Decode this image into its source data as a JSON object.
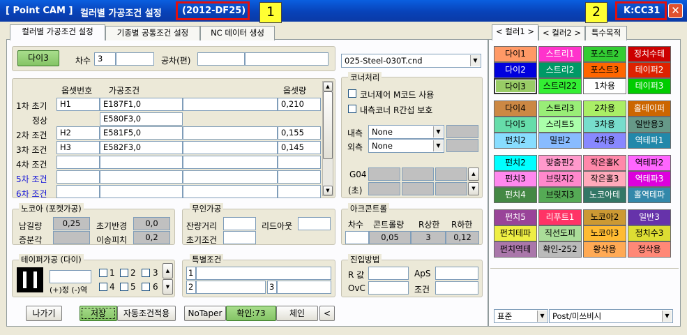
{
  "title": {
    "app": "[ Point CAM ]",
    "screen": "컬러별 가공조건 설정",
    "code": "(2012-DF25)",
    "marker1": "1",
    "marker2": "2",
    "machine": "K:CC31",
    "close": "✕"
  },
  "tabs": [
    "컬러별 가공조건 설정",
    "기종별 공통조건 설정",
    "NC 데이터 생성"
  ],
  "color_tabs": [
    "< 컬러1 >",
    "< 컬러2 >",
    "특수목적"
  ],
  "top": {
    "dia_btn": "다이3",
    "cha_label": "차수",
    "cha_value": "3",
    "gongcha_label": "공차(편)",
    "file": "025-Steel-030T.cnd"
  },
  "offset": {
    "col_offset_no": "옵셋번호",
    "col_cond": "가공조건",
    "col_amount": "옵셋량",
    "rows": [
      {
        "label": "1차 초기",
        "no": "H1",
        "cond": "E187F1,0",
        "amount": "0,210"
      },
      {
        "label": "정상",
        "no": "",
        "cond": "E580F3,0",
        "amount": ""
      },
      {
        "label": "2차 조건",
        "no": "H2",
        "cond": "E581F5,0",
        "amount": "0,155"
      },
      {
        "label": "3차 조건",
        "no": "H3",
        "cond": "E582F3,0",
        "amount": "0,145"
      },
      {
        "label": "4차 조건",
        "no": "",
        "cond": "",
        "amount": ""
      },
      {
        "label": "5차 조건",
        "no": "",
        "cond": "",
        "amount": ""
      },
      {
        "label": "6차 조건",
        "no": "",
        "cond": "",
        "amount": ""
      }
    ]
  },
  "corner": {
    "title": "코너처리",
    "opt1": "코너제어 M코드 사용",
    "opt2": "내측코너 R간섭 보호",
    "inner_label": "내측",
    "inner_val": "None",
    "outer_label": "외측",
    "outer_val": "None",
    "g04": "G04",
    "sec": "(초)"
  },
  "noaoa": {
    "title": "노코아 (포켓가공)",
    "rem_label": "남길량",
    "rem_val": "0,25",
    "r_label": "초기반경",
    "r_val": "0,0",
    "inc_label": "증분각",
    "pitch_label": "이송피치",
    "pitch_val": "0,2"
  },
  "unmanned": {
    "title": "무인가공",
    "dist_label": "잔량거리",
    "leadout_label": "리드아웃",
    "init_label": "초기조건"
  },
  "arc": {
    "title": "아크콘트롤",
    "h1": "차수",
    "h2": "콘트롤량",
    "h3": "R상한",
    "h4": "R하한",
    "v2": "0,05",
    "v3": "3",
    "v4": "0,12"
  },
  "taper": {
    "title": "테이퍼가공 (다이)",
    "sign": "(+)정 (-)역",
    "c1": "1",
    "c2": "2",
    "c3": "3",
    "c4": "4",
    "c5": "5",
    "c6": "6"
  },
  "special": {
    "title": "특별조건",
    "n1": "1",
    "n2": "2",
    "n3": "3"
  },
  "approach": {
    "title": "진입방법",
    "r_label": "R 값",
    "aps_label": "ApS",
    "ovc_label": "OvC",
    "cond_label": "조건"
  },
  "bottom": {
    "exit": "나가기",
    "save": "저장",
    "auto": "자동조건적용",
    "notaper": "NoTaper",
    "confirm": "확인:73",
    "chain": "체인",
    "back": "<"
  },
  "palette": [
    [
      {
        "t": "다이1",
        "bg": "#ff9966"
      },
      {
        "t": "스트리1",
        "bg": "#ff33cc"
      },
      {
        "t": "포스트2",
        "bg": "#33cc33"
      },
      {
        "t": "정치수테",
        "bg": "#cc0000"
      }
    ],
    [
      {
        "t": "다이2",
        "bg": "#0000dd"
      },
      {
        "t": "스트리2",
        "bg": "#009966"
      },
      {
        "t": "포스트3",
        "bg": "#ff6600"
      },
      {
        "t": "테이퍼2",
        "bg": "#dd2200"
      }
    ],
    [
      {
        "t": "다이3",
        "bg": "#99cc66"
      },
      {
        "t": "스트리22",
        "bg": "#33ee33"
      },
      {
        "t": "1차용",
        "bg": "#ffffff"
      },
      {
        "t": "테이퍼3",
        "bg": "#00cc00"
      }
    ],
    [
      {
        "t": "다이4",
        "bg": "#cc8844"
      },
      {
        "t": "스트리3",
        "bg": "#99ee77"
      },
      {
        "t": "2차용",
        "bg": "#aaee66"
      },
      {
        "t": "홀테이퍼",
        "bg": "#cc6600"
      }
    ],
    [
      {
        "t": "다이5",
        "bg": "#66ddaa"
      },
      {
        "t": "스리트5",
        "bg": "#aaffaa"
      },
      {
        "t": "3차용",
        "bg": "#77ddcc"
      },
      {
        "t": "일반용3",
        "bg": "#669988"
      }
    ],
    [
      {
        "t": "펀치2",
        "bg": "#88ddff"
      },
      {
        "t": "밀핀2",
        "bg": "#88bbff"
      },
      {
        "t": "4차용",
        "bg": "#8888ff"
      },
      {
        "t": "역테파1",
        "bg": "#2288aa"
      }
    ],
    [
      {
        "t": "펀치2",
        "bg": "#00ffff"
      },
      {
        "t": "맞춤핀2",
        "bg": "#ff99cc"
      },
      {
        "t": "작은홀K",
        "bg": "#ff88aa"
      },
      {
        "t": "역테파2",
        "bg": "#ff66ff"
      }
    ],
    [
      {
        "t": "펀치3",
        "bg": "#ff88ee"
      },
      {
        "t": "브릿지2",
        "bg": "#ff88cc"
      },
      {
        "t": "작은홀3",
        "bg": "#ffaabb"
      },
      {
        "t": "역테파3",
        "bg": "#dd00dd"
      }
    ],
    [
      {
        "t": "펀치4",
        "bg": "#448844"
      },
      {
        "t": "브릿지3",
        "bg": "#55aa55"
      },
      {
        "t": "노코아테",
        "bg": "#337766"
      },
      {
        "t": "홀역테파",
        "bg": "#3388aa"
      }
    ],
    [
      {
        "t": "펀치5",
        "bg": "#994499"
      },
      {
        "t": "리푸트1",
        "bg": "#ff3366"
      },
      {
        "t": "노코아2",
        "bg": "#cc9933"
      },
      {
        "t": "일반3",
        "bg": "#6633aa"
      }
    ],
    [
      {
        "t": "펀치테파",
        "bg": "#eeee44"
      },
      {
        "t": "직선도피",
        "bg": "#aadd99"
      },
      {
        "t": "노코아3",
        "bg": "#ffbb33"
      },
      {
        "t": "정치수3",
        "bg": "#dddd33"
      }
    ],
    [
      {
        "t": "펀치역테",
        "bg": "#aa77aa"
      },
      {
        "t": "확인-252",
        "bg": "#bbbbbb"
      },
      {
        "t": "황삭용",
        "bg": "#ffaa55"
      },
      {
        "t": "정삭용",
        "bg": "#ff8877"
      }
    ]
  ],
  "footer": {
    "std": "표준",
    "post": "Post/미쓰비시"
  }
}
